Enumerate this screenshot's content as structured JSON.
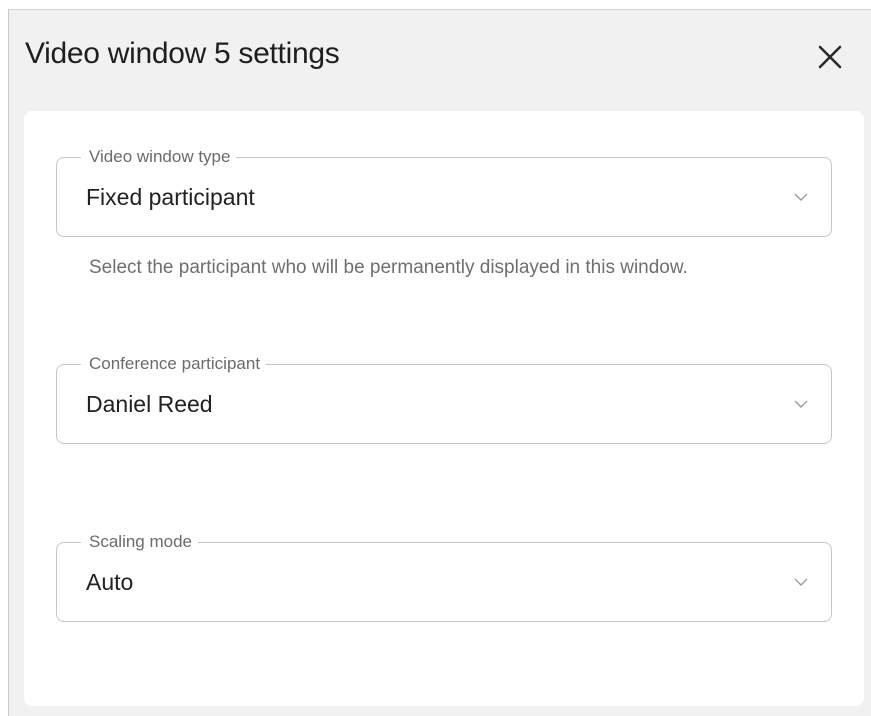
{
  "dialog": {
    "title": "Video window 5 settings",
    "close_icon": "close-icon"
  },
  "fields": {
    "video_window_type": {
      "label": "Video window type",
      "value": "Fixed participant",
      "help": "Select the participant who will be permanently displayed in this window."
    },
    "conference_participant": {
      "label": "Conference participant",
      "value": "Daniel Reed"
    },
    "scaling_mode": {
      "label": "Scaling mode",
      "value": "Auto"
    }
  },
  "colors": {
    "dialog_bg": "#f1f1f1",
    "card_bg": "#ffffff",
    "field_border": "#c7c7c7",
    "label_text": "#6b6b6b",
    "value_text": "#222222"
  }
}
